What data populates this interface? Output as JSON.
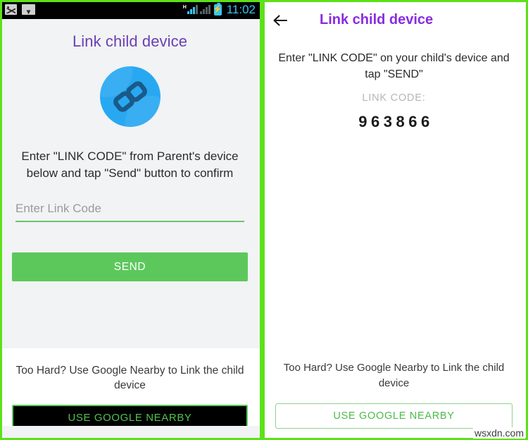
{
  "left_panel": {
    "statusbar": {
      "icons_left": [
        "image-icon",
        "wifi-icon"
      ],
      "network_type": "H",
      "icons_right": [
        "signal-icon",
        "signal-secondary-icon",
        "battery-charging-icon"
      ],
      "time": "11:02"
    },
    "title": "Link child device",
    "hero_icon": "chain-link-icon",
    "instruction": "Enter \"LINK CODE\" from Parent's device below and tap \"Send\" button to confirm",
    "input": {
      "placeholder": "Enter Link Code",
      "value": ""
    },
    "send_label": "SEND",
    "nearby_prompt": "Too Hard? Use Google Nearby to Link the child device",
    "nearby_label": "USE GOOGLE NEARBY"
  },
  "right_panel": {
    "back_icon": "back-arrow-icon",
    "title": "Link child device",
    "instruction": "Enter \"LINK CODE\" on your child's device and tap \"SEND\"",
    "link_code_label": "LINK CODE:",
    "link_code_value": "963866",
    "nearby_prompt": "Too Hard? Use Google Nearby to Link the child device",
    "nearby_label": "USE GOOGLE NEARBY"
  },
  "watermark": "wsxdn.com",
  "colors": {
    "frame_green": "#5de118",
    "purple_left": "#6b3fb5",
    "purple_right": "#8a2be2",
    "green_button": "#5cc85c",
    "green_outline": "#8bd68b",
    "blue_circle": "#29a8f2",
    "blue_link": "#1a5a8a",
    "status_cyan": "#35c5f0"
  }
}
